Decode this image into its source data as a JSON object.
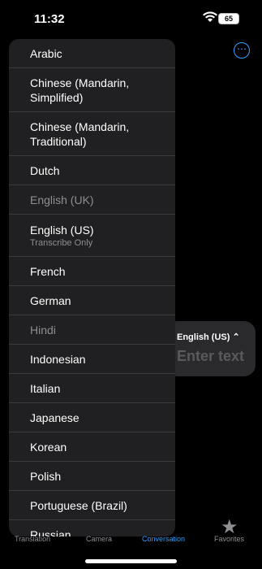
{
  "status": {
    "time": "11:32",
    "battery": "65"
  },
  "header": {
    "more_icon": "ellipsis-circle-icon"
  },
  "background": {
    "language": "English (US) ⌃",
    "placeholder": "Enter text"
  },
  "languages": [
    {
      "label": "Arabic",
      "dim": false
    },
    {
      "label": "Chinese (Mandarin, Simplified)",
      "dim": false
    },
    {
      "label": "Chinese (Mandarin, Traditional)",
      "dim": false
    },
    {
      "label": "Dutch",
      "dim": false
    },
    {
      "label": "English (UK)",
      "dim": true
    },
    {
      "label": "English (US)",
      "sub": "Transcribe Only",
      "dim": false
    },
    {
      "label": "French",
      "dim": false
    },
    {
      "label": "German",
      "dim": false
    },
    {
      "label": "Hindi",
      "dim": true
    },
    {
      "label": "Indonesian",
      "dim": false
    },
    {
      "label": "Italian",
      "dim": false
    },
    {
      "label": "Japanese",
      "dim": false
    },
    {
      "label": "Korean",
      "dim": false
    },
    {
      "label": "Polish",
      "dim": false
    },
    {
      "label": "Portuguese (Brazil)",
      "dim": false
    },
    {
      "label": "Russian",
      "dim": false
    }
  ],
  "tabs": [
    {
      "label": "Translation",
      "active": false
    },
    {
      "label": "Camera",
      "active": false
    },
    {
      "label": "Conversation",
      "active": true
    },
    {
      "label": "Favorites",
      "active": false
    }
  ],
  "colors": {
    "accent": "#2a9df4",
    "menu_bg": "#202022"
  }
}
